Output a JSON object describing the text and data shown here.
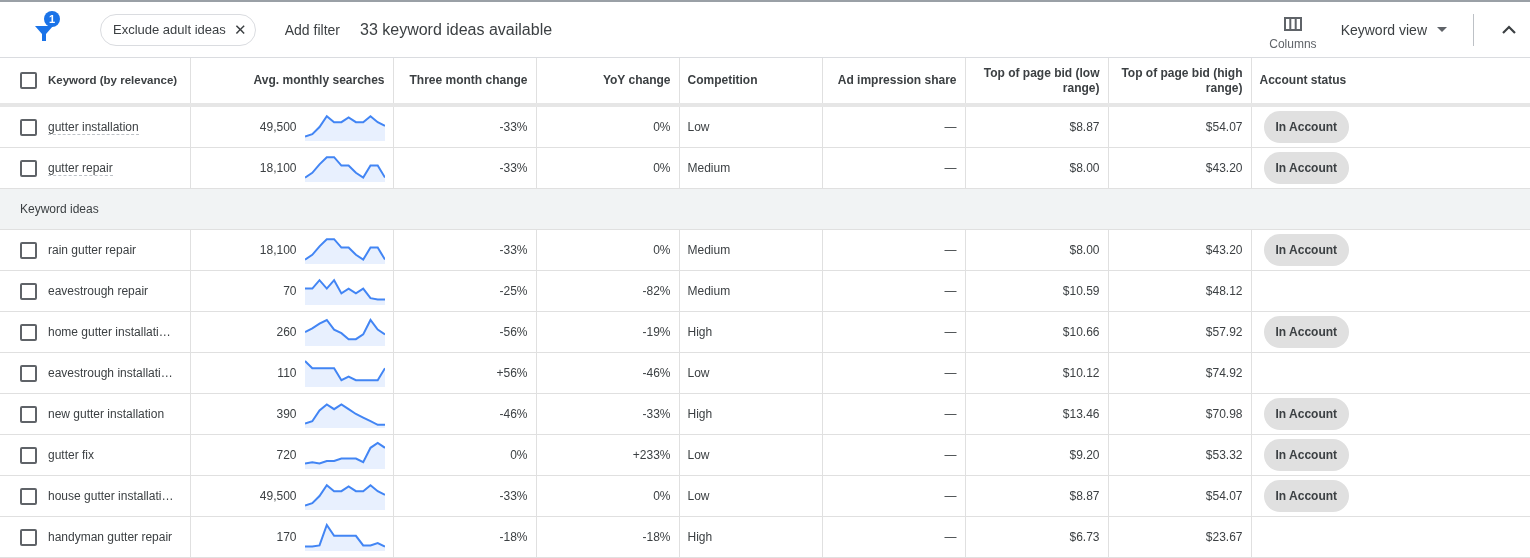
{
  "toolbar": {
    "filter_count": "1",
    "chips": [
      {
        "label": "Exclude adult ideas",
        "close": "✕"
      }
    ],
    "add_filter": "Add filter",
    "summary": "33 keyword ideas available",
    "columns_label": "Columns",
    "view_menu": "Keyword view"
  },
  "table": {
    "columns": [
      {
        "label": "Keyword (by relevance)"
      },
      {
        "label": "Avg. monthly searches"
      },
      {
        "label": "Three month change"
      },
      {
        "label": "YoY change"
      },
      {
        "label": "Competition"
      },
      {
        "label": "Ad impression share"
      },
      {
        "label": "Top of page bid (low range)"
      },
      {
        "label": "Top of page bid (high range)"
      },
      {
        "label": "Account status"
      }
    ],
    "header_checked": false,
    "sections": [
      {
        "rows": [
          {
            "keyword": "gutter installation",
            "underlined": true,
            "checked": false,
            "searches": "49,500",
            "three_month": "-33%",
            "yoy": "0%",
            "competition": "Low",
            "impression": "—",
            "bid_low": "$8.87",
            "bid_high": "$54.07",
            "status": "In Account"
          },
          {
            "keyword": "gutter repair",
            "underlined": true,
            "checked": false,
            "searches": "18,100",
            "three_month": "-33%",
            "yoy": "0%",
            "competition": "Medium",
            "impression": "—",
            "bid_low": "$8.00",
            "bid_high": "$43.20",
            "status": "In Account"
          }
        ]
      },
      {
        "title": "Keyword ideas",
        "rows": [
          {
            "keyword": "rain gutter repair",
            "underlined": false,
            "checked": false,
            "searches": "18,100",
            "three_month": "-33%",
            "yoy": "0%",
            "competition": "Medium",
            "impression": "—",
            "bid_low": "$8.00",
            "bid_high": "$43.20",
            "status": "In Account"
          },
          {
            "keyword": "eavestrough repair",
            "underlined": false,
            "checked": false,
            "searches": "70",
            "three_month": "-25%",
            "yoy": "-82%",
            "competition": "Medium",
            "impression": "—",
            "bid_low": "$10.59",
            "bid_high": "$48.12"
          },
          {
            "keyword": "home gutter installati…",
            "underlined": false,
            "checked": false,
            "searches": "260",
            "three_month": "-56%",
            "yoy": "-19%",
            "competition": "High",
            "impression": "—",
            "bid_low": "$10.66",
            "bid_high": "$57.92",
            "status": "In Account"
          },
          {
            "keyword": "eavestrough installati…",
            "underlined": false,
            "checked": false,
            "searches": "110",
            "three_month": "+56%",
            "yoy": "-46%",
            "competition": "Low",
            "impression": "—",
            "bid_low": "$10.12",
            "bid_high": "$74.92"
          },
          {
            "keyword": "new gutter installation",
            "underlined": false,
            "checked": false,
            "searches": "390",
            "three_month": "-46%",
            "yoy": "-33%",
            "competition": "High",
            "impression": "—",
            "bid_low": "$13.46",
            "bid_high": "$70.98",
            "status": "In Account"
          },
          {
            "keyword": "gutter fix",
            "underlined": false,
            "checked": false,
            "searches": "720",
            "three_month": "0%",
            "yoy": "+233%",
            "competition": "Low",
            "impression": "—",
            "bid_low": "$9.20",
            "bid_high": "$53.32",
            "status": "In Account"
          },
          {
            "keyword": "house gutter installati…",
            "underlined": false,
            "checked": false,
            "searches": "49,500",
            "three_month": "-33%",
            "yoy": "0%",
            "competition": "Low",
            "impression": "—",
            "bid_low": "$8.87",
            "bid_high": "$54.07",
            "status": "In Account"
          },
          {
            "keyword": "handyman gutter repair",
            "underlined": false,
            "checked": false,
            "searches": "170",
            "three_month": "-18%",
            "yoy": "-18%",
            "competition": "High",
            "impression": "—",
            "bid_low": "$6.73",
            "bid_high": "$23.67"
          }
        ]
      }
    ]
  }
}
